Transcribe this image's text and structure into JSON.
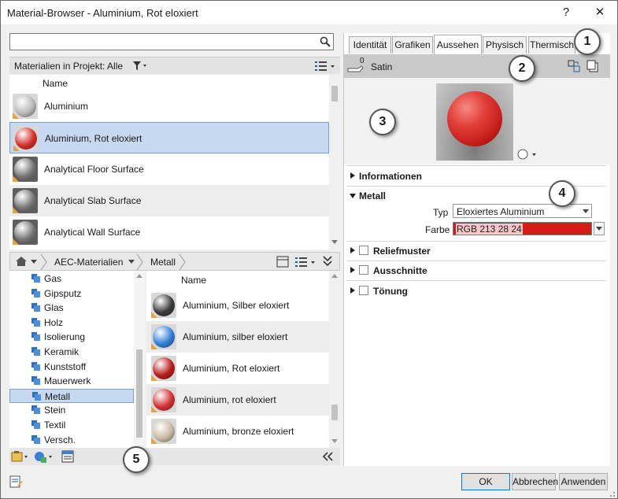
{
  "window": {
    "title": "Material-Browser - Aluminium, Rot eloxiert",
    "help": "?",
    "close": "✕"
  },
  "search": {
    "placeholder": "",
    "icon": "search-icon"
  },
  "project_filter": {
    "label": "Materialien in Projekt: Alle",
    "icon": "filter-icon"
  },
  "project_list": {
    "header": "Name",
    "items": [
      {
        "name": "Aluminium",
        "color": "#b8b8b8",
        "selected": false
      },
      {
        "name": "Aluminium, Rot eloxiert",
        "color": "#d42c26",
        "selected": true
      },
      {
        "name": "Analytical Floor Surface",
        "color": "#777777",
        "selected": false
      },
      {
        "name": "Analytical Slab Surface",
        "color": "#777777",
        "selected": false
      },
      {
        "name": "Analytical Wall Surface",
        "color": "#777777",
        "selected": false
      }
    ]
  },
  "breadcrumb": {
    "items": [
      "AEC-Materialien",
      "Metall"
    ]
  },
  "tree": {
    "items": [
      {
        "label": "Gas",
        "selected": false
      },
      {
        "label": "Gipsputz",
        "selected": false
      },
      {
        "label": "Glas",
        "selected": false
      },
      {
        "label": "Holz",
        "selected": false
      },
      {
        "label": "Isolierung",
        "selected": false
      },
      {
        "label": "Keramik",
        "selected": false
      },
      {
        "label": "Kunststoff",
        "selected": false
      },
      {
        "label": "Mauerwerk",
        "selected": false
      },
      {
        "label": "Metall",
        "selected": true
      },
      {
        "label": "Stein",
        "selected": false
      },
      {
        "label": "Textil",
        "selected": false
      },
      {
        "label": "Versch.",
        "selected": false
      }
    ]
  },
  "library_list": {
    "header": "Name",
    "items": [
      {
        "name": "Aluminium, Silber eloxiert",
        "color": "#3a3a3a"
      },
      {
        "name": "Aluminium, silber eloxiert",
        "color": "#2f7fd6"
      },
      {
        "name": "Aluminium, Rot eloxiert",
        "color": "#b81818"
      },
      {
        "name": "Aluminium, rot eloxiert",
        "color": "#d43030"
      },
      {
        "name": "Aluminium, bronze eloxiert",
        "color": "#c9b9a4"
      }
    ]
  },
  "tabs": [
    "Identität",
    "Grafiken",
    "Aussehen",
    "Physisch",
    "Thermisch"
  ],
  "active_tab": "Aussehen",
  "appearance": {
    "usage_count": "0",
    "asset_name": "Satin",
    "sections": {
      "info": "Informationen",
      "metal": "Metall",
      "relief": "Reliefmuster",
      "cutouts": "Ausschnitte",
      "tint": "Tönung"
    },
    "type_label": "Typ",
    "type_value": "Eloxiertes Aluminium",
    "color_label": "Farbe",
    "color_value": "RGB 213 28 24",
    "color_hex": "#d51c18"
  },
  "callouts": [
    "1",
    "2",
    "3",
    "4",
    "5"
  ],
  "footer": {
    "ok": "OK",
    "cancel": "Abbrechen",
    "apply": "Anwenden"
  }
}
